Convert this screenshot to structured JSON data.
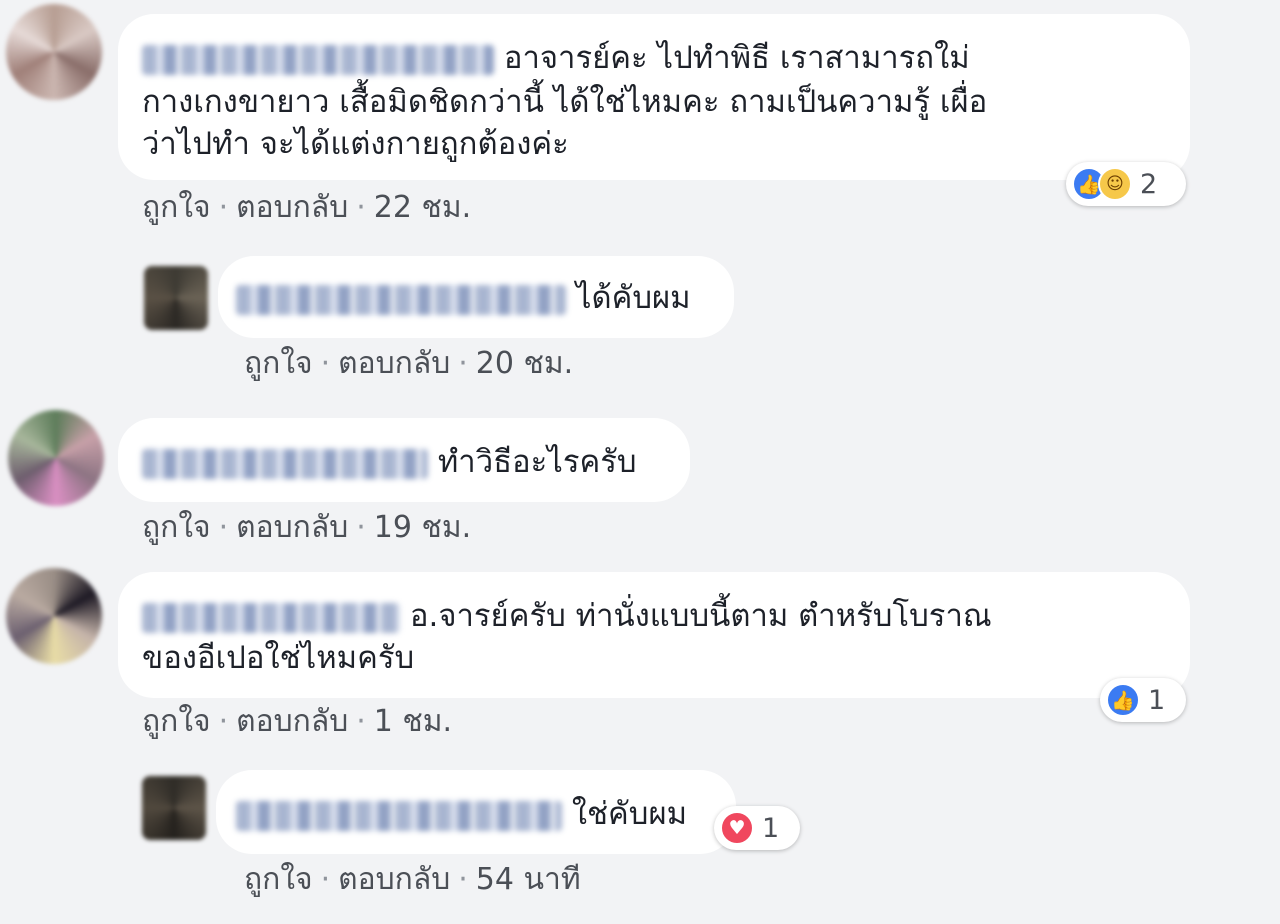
{
  "comments": [
    {
      "text_line1": "อาจารย์คะ ไปทำพิธี เราสามารถใม่",
      "text_line2": "กางเกงขายาว เสื้อมิดชิดกว่านี้ ได้ใช่ไหมคะ ถามเป็นความรู้ เผื่อ",
      "text_line3": "ว่าไปทำ จะได้แต่งกายถูกต้องค่ะ",
      "like_label": "ถูกใจ",
      "reply_label": "ตอบกลับ",
      "separator": "·",
      "time": "22 ชม.",
      "reaction_count": "2",
      "reactions": [
        "like-icon",
        "haha-icon"
      ]
    },
    {
      "text_line1": "ได้คับผม",
      "like_label": "ถูกใจ",
      "reply_label": "ตอบกลับ",
      "separator": "·",
      "time": "20 ชม."
    },
    {
      "text_line1": "ทำวิธีอะไรครับ",
      "like_label": "ถูกใจ",
      "reply_label": "ตอบกลับ",
      "separator": "·",
      "time": "19 ชม."
    },
    {
      "text_line1": "อ.จารย์ครับ ท่านั่งแบบนี้ตาม ตำหรับโบราณ",
      "text_line2": "ของอีเปอใช่ไหมครับ",
      "like_label": "ถูกใจ",
      "reply_label": "ตอบกลับ",
      "separator": "·",
      "time": "1 ชม.",
      "reaction_count": "1",
      "reactions": [
        "like-icon"
      ]
    },
    {
      "text_line1": "ใช่คับผม",
      "like_label": "ถูกใจ",
      "reply_label": "ตอบกลับ",
      "separator": "·",
      "time": "54 นาที",
      "reaction_count": "1",
      "reactions": [
        "love-icon"
      ]
    }
  ],
  "colors": {
    "background": "#f2f3f5",
    "bubble": "#ffffff",
    "like_blue": "#3b7bf2",
    "love_red": "#f0475e",
    "haha_yellow": "#f6c84a"
  }
}
